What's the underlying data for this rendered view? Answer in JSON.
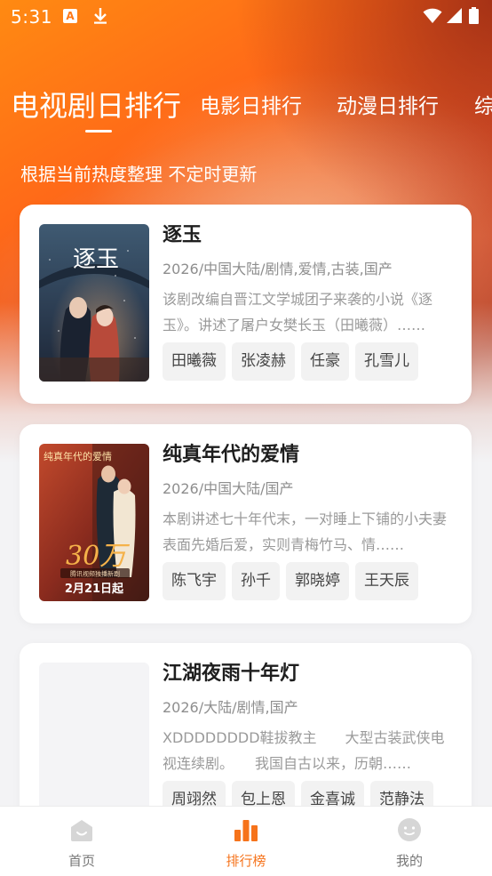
{
  "status_bar": {
    "time": "5:31",
    "notification_letter": "A"
  },
  "tabs": [
    {
      "label": "电视剧日排行",
      "active": true
    },
    {
      "label": "电影日排行",
      "active": false
    },
    {
      "label": "动漫日排行",
      "active": false
    },
    {
      "label": "综",
      "active": false
    }
  ],
  "subtitle": "根据当前热度整理 不定时更新",
  "dramas": [
    {
      "title": "逐玉",
      "meta": "2026/中国大陆/剧情,爱情,古装,国产",
      "description": "该剧改编自晋江文学城团子来袭的小说《逐玉》。讲述了屠户女樊长玉（田曦薇）……",
      "cast": [
        "田曦薇",
        "张凌赫",
        "任豪",
        "孔雪儿"
      ],
      "poster_text": "逐玉"
    },
    {
      "title": "纯真年代的爱情",
      "meta": "2026/中国大陆/国产",
      "description": "本剧讲述七十年代末，一对睡上下铺的小夫妻表面先婚后爱，实则青梅竹马、情……",
      "cast": [
        "陈飞宇",
        "孙千",
        "郭晓婷",
        "王天辰"
      ],
      "poster_text": {
        "title": "纯真年代的爱情",
        "number": "30万",
        "caption": "腾讯视频独播新剧",
        "date": "2月21日起"
      }
    },
    {
      "title": "江湖夜雨十年灯",
      "meta": "2026/大陆/剧情,国产",
      "description": "XDDDDDDDD鞋拔教主　　大型古装武侠电视连续剧。　　我国自古以来，历朝……",
      "cast": [
        "周翊然",
        "包上恩",
        "金喜诚",
        "范静法"
      ]
    }
  ],
  "bottom_nav": [
    {
      "label": "首页",
      "icon": "home-icon",
      "active": false
    },
    {
      "label": "排行榜",
      "icon": "bar-chart-icon",
      "active": true
    },
    {
      "label": "我的",
      "icon": "smiley-icon",
      "active": false
    }
  ],
  "colors": {
    "accent": "#f6731b",
    "hero_start": "#ff8a12",
    "hero_end": "#c8472a"
  }
}
